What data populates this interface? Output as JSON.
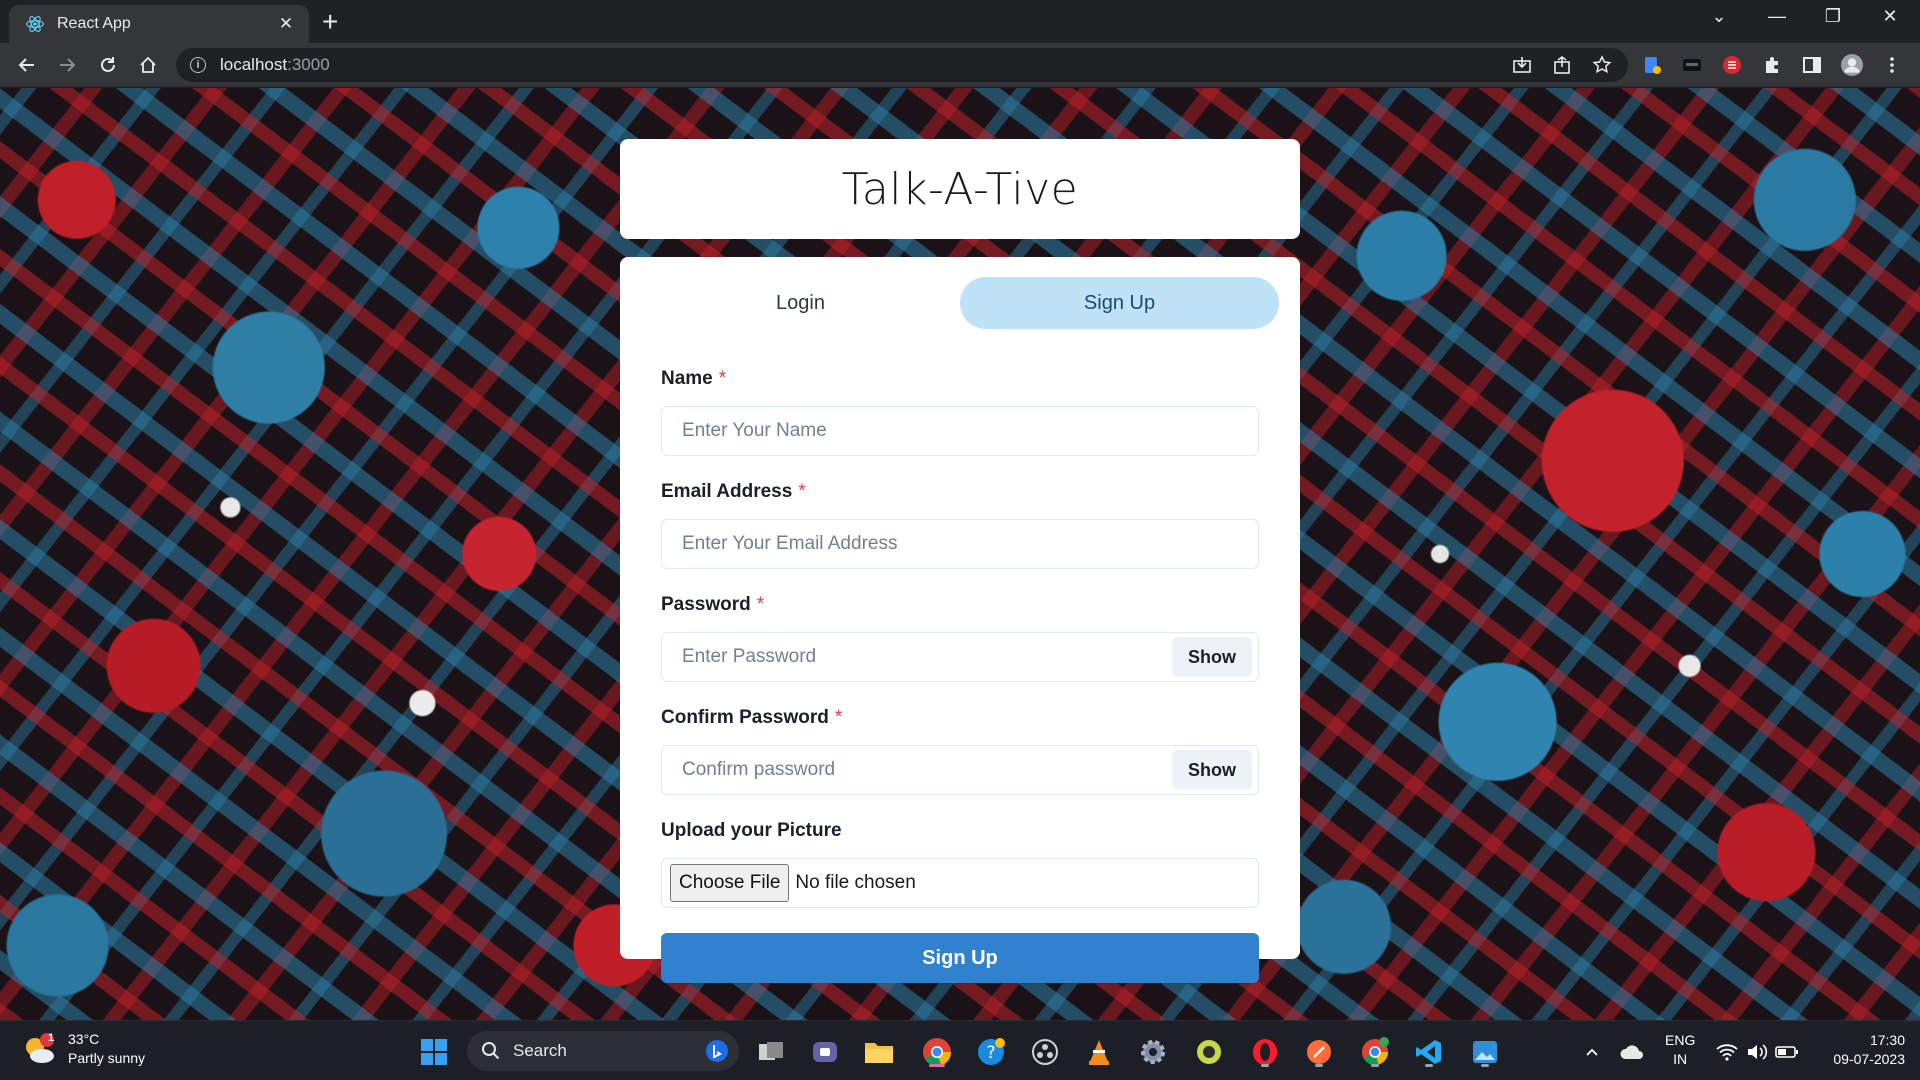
{
  "browser": {
    "tab_title": "React App",
    "url_host": "localhost",
    "url_port": ":3000"
  },
  "app": {
    "title": "Talk-A-Tive",
    "tabs": [
      {
        "label": "Login",
        "active": false
      },
      {
        "label": "Sign Up",
        "active": true
      }
    ],
    "fields": {
      "name": {
        "label": "Name",
        "placeholder": "Enter Your Name",
        "required": "*"
      },
      "email": {
        "label": "Email Address",
        "placeholder": "Enter Your Email Address",
        "required": "*"
      },
      "password": {
        "label": "Password",
        "placeholder": "Enter Password",
        "required": "*",
        "toggle": "Show"
      },
      "confirm": {
        "label": "Confirm Password",
        "placeholder": "Confirm password",
        "required": "*",
        "toggle": "Show"
      },
      "picture": {
        "label": "Upload your Picture",
        "button": "Choose File",
        "status": "No file chosen"
      }
    },
    "submit_label": "Sign Up"
  },
  "taskbar": {
    "weather_temp": "33°C",
    "weather_desc": "Partly sunny",
    "weather_badge": "1",
    "search_label": "Search",
    "lang_top": "ENG",
    "lang_bottom": "IN",
    "time": "17:30",
    "date": "09-07-2023"
  },
  "colors": {
    "tab_active_bg": "#bee3f8",
    "submit_bg": "#3182ce",
    "required": "#e53e3e"
  }
}
